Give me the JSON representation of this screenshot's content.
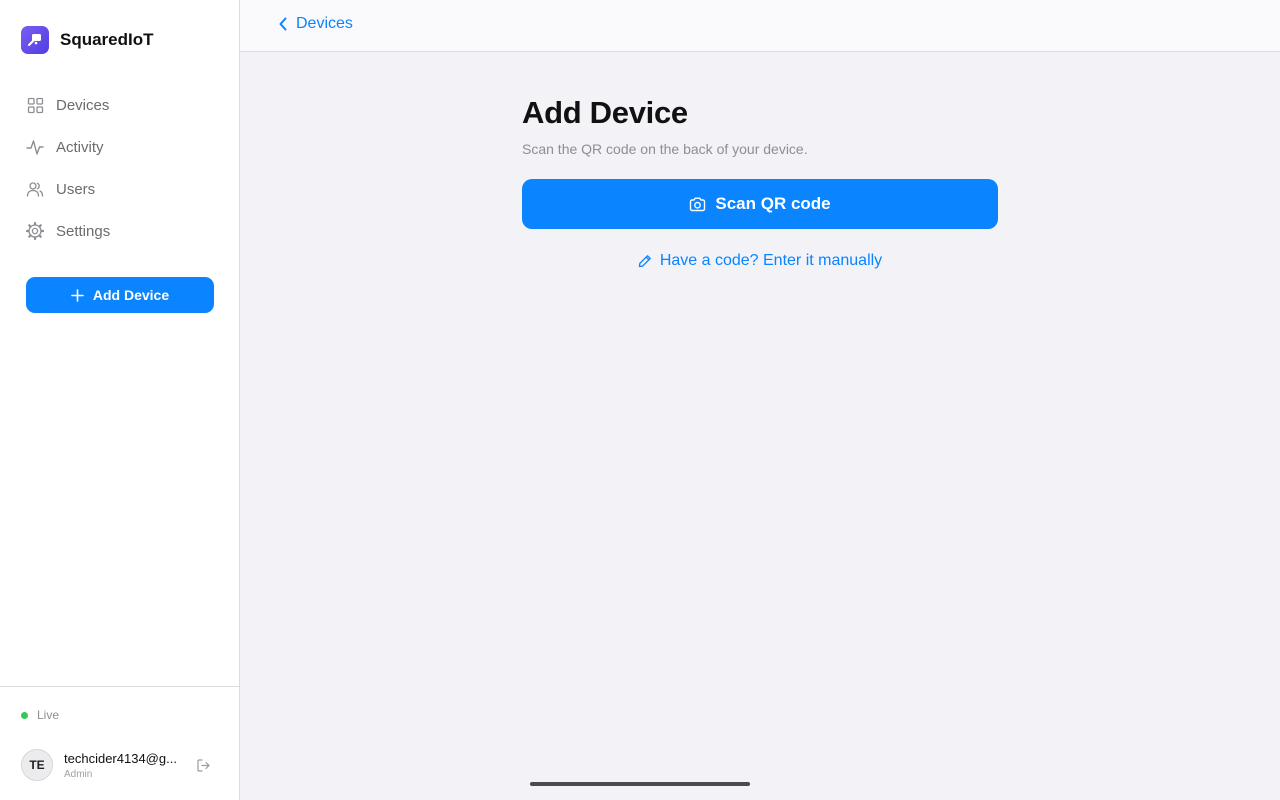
{
  "app": {
    "name": "SquaredIoT"
  },
  "sidebar": {
    "items": [
      {
        "label": "Devices",
        "icon": "grid-icon"
      },
      {
        "label": "Activity",
        "icon": "activity-icon"
      },
      {
        "label": "Users",
        "icon": "users-icon"
      },
      {
        "label": "Settings",
        "icon": "gear-icon"
      }
    ],
    "add_button_label": "Add Device"
  },
  "status": {
    "label": "Live",
    "color": "#34c759"
  },
  "user": {
    "initials": "TE",
    "email": "techcider4134@g...",
    "role": "Admin"
  },
  "topbar": {
    "back_label": "Devices"
  },
  "main": {
    "title": "Add Device",
    "subtitle": "Scan the QR code on the back of your device.",
    "scan_button_label": "Scan QR code",
    "manual_link_label": "Have a code? Enter it manually"
  },
  "colors": {
    "accent": "#0a84ff",
    "brand": "#5b45e8"
  }
}
